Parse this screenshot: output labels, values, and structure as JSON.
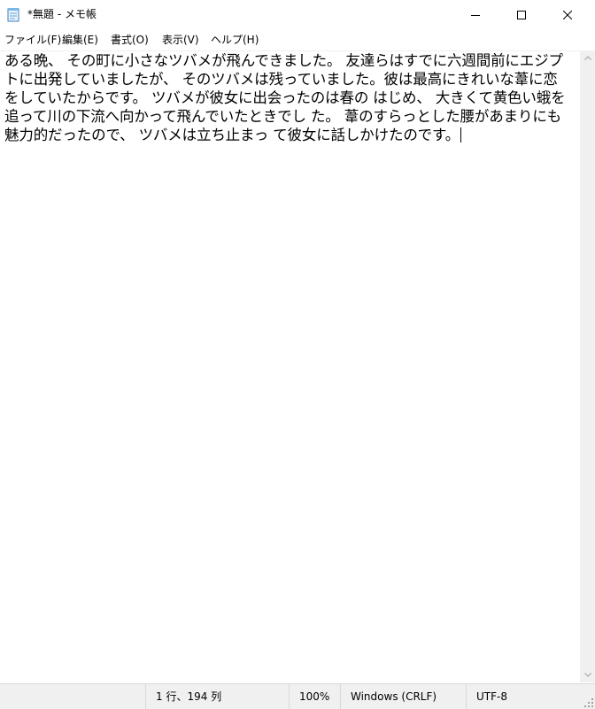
{
  "window": {
    "title": "*無題 - メモ帳",
    "icon": "notepad-icon"
  },
  "menu": [
    {
      "label": "ファイル(F)"
    },
    {
      "label": "編集(E)"
    },
    {
      "label": "書式(O)"
    },
    {
      "label": "表示(V)"
    },
    {
      "label": "ヘルプ(H)"
    }
  ],
  "editor": {
    "content": "ある晩、 その町に小さなツバメが飛んできました。 友達らはすでに六週間前にエジプトに出発していましたが、 そのツバメは残っていました。彼は最高にきれいな葦に恋をしていたからです。 ツバメが彼女に出会ったのは春の はじめ、 大きくて黄色い蛾を追って川の下流へ向かって飛んでいたときでし た。 葦のすらっとした腰があまりにも魅力的だったので、 ツバメは立ち止まっ て彼女に話しかけたのです。"
  },
  "status": {
    "position": "1 行、194 列",
    "zoom": "100%",
    "line_ending": "Windows (CRLF)",
    "encoding": "UTF-8"
  }
}
